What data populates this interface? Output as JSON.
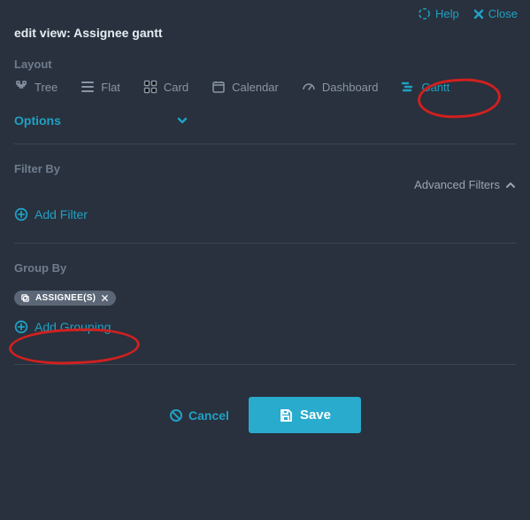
{
  "header": {
    "help_label": "Help",
    "close_label": "Close",
    "title": "edit view: Assignee gantt"
  },
  "layout": {
    "section_label": "Layout",
    "items": [
      {
        "id": "tree",
        "label": "Tree"
      },
      {
        "id": "flat",
        "label": "Flat"
      },
      {
        "id": "card",
        "label": "Card"
      },
      {
        "id": "calendar",
        "label": "Calendar"
      },
      {
        "id": "dashboard",
        "label": "Dashboard"
      },
      {
        "id": "gantt",
        "label": "Gantt"
      }
    ],
    "active": "gantt"
  },
  "options": {
    "label": "Options"
  },
  "filter": {
    "section_label": "Filter By",
    "advanced_label": "Advanced Filters",
    "add_label": "Add Filter"
  },
  "group": {
    "section_label": "Group By",
    "chips": [
      {
        "label": "ASSIGNEE(S)"
      }
    ],
    "add_label": "Add Grouping"
  },
  "footer": {
    "cancel_label": "Cancel",
    "save_label": "Save"
  }
}
